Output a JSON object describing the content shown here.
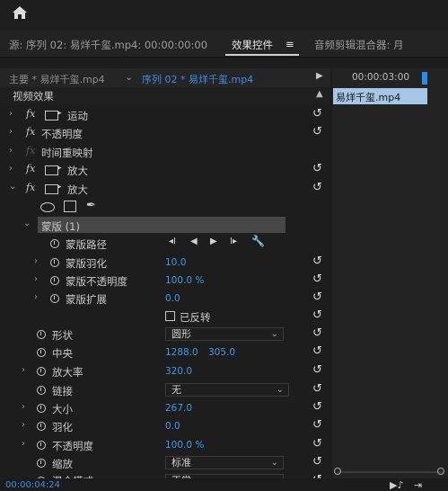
{
  "tabs": {
    "source": "源: 序列 02: 易烊千玺.mp4: 00:00:00:00",
    "effect_controls": "效果控件",
    "menu_icon": "≡",
    "audio_mixer": "音频剪辑混合器: 月"
  },
  "header": {
    "source_clip": "主要 * 易烊千玺.mp4",
    "sequence_clip": "序列 02 * 易烊千玺.mp4"
  },
  "timeline": {
    "timecode": "00:00:03:00",
    "clip_label": "易烊千玺.mp4"
  },
  "section_title": "视频效果",
  "effects": {
    "motion": "运动",
    "opacity": "不透明度",
    "time_remap": "时间重映射",
    "zoom1": "放大",
    "zoom2": "放大"
  },
  "mask": {
    "name": "蒙版 (1)",
    "path_label": "蒙版路径",
    "feather_label": "蒙版羽化",
    "feather_value": "10.0",
    "opacity_label": "蒙版不透明度",
    "opacity_value": "100.0 %",
    "expansion_label": "蒙版扩展",
    "expansion_value": "0.0",
    "inverted_label": "已反转"
  },
  "params": {
    "shape_label": "形状",
    "shape_value": "圆形",
    "center_label": "中央",
    "center_x": "1288.0",
    "center_y": "305.0",
    "magnify_label": "放大率",
    "magnify_value": "320.0",
    "link_label": "链接",
    "link_value": "无",
    "size_label": "大小",
    "size_value": "267.0",
    "feather_label": "羽化",
    "feather_value": "0.0",
    "opacity_label": "不透明度",
    "opacity_value": "100.0 %",
    "scale_label": "缩放",
    "scale_value": "标准",
    "extra_label": "混合模式",
    "extra_value": "正常"
  },
  "footer": {
    "current_time": "00:00:04:24"
  }
}
